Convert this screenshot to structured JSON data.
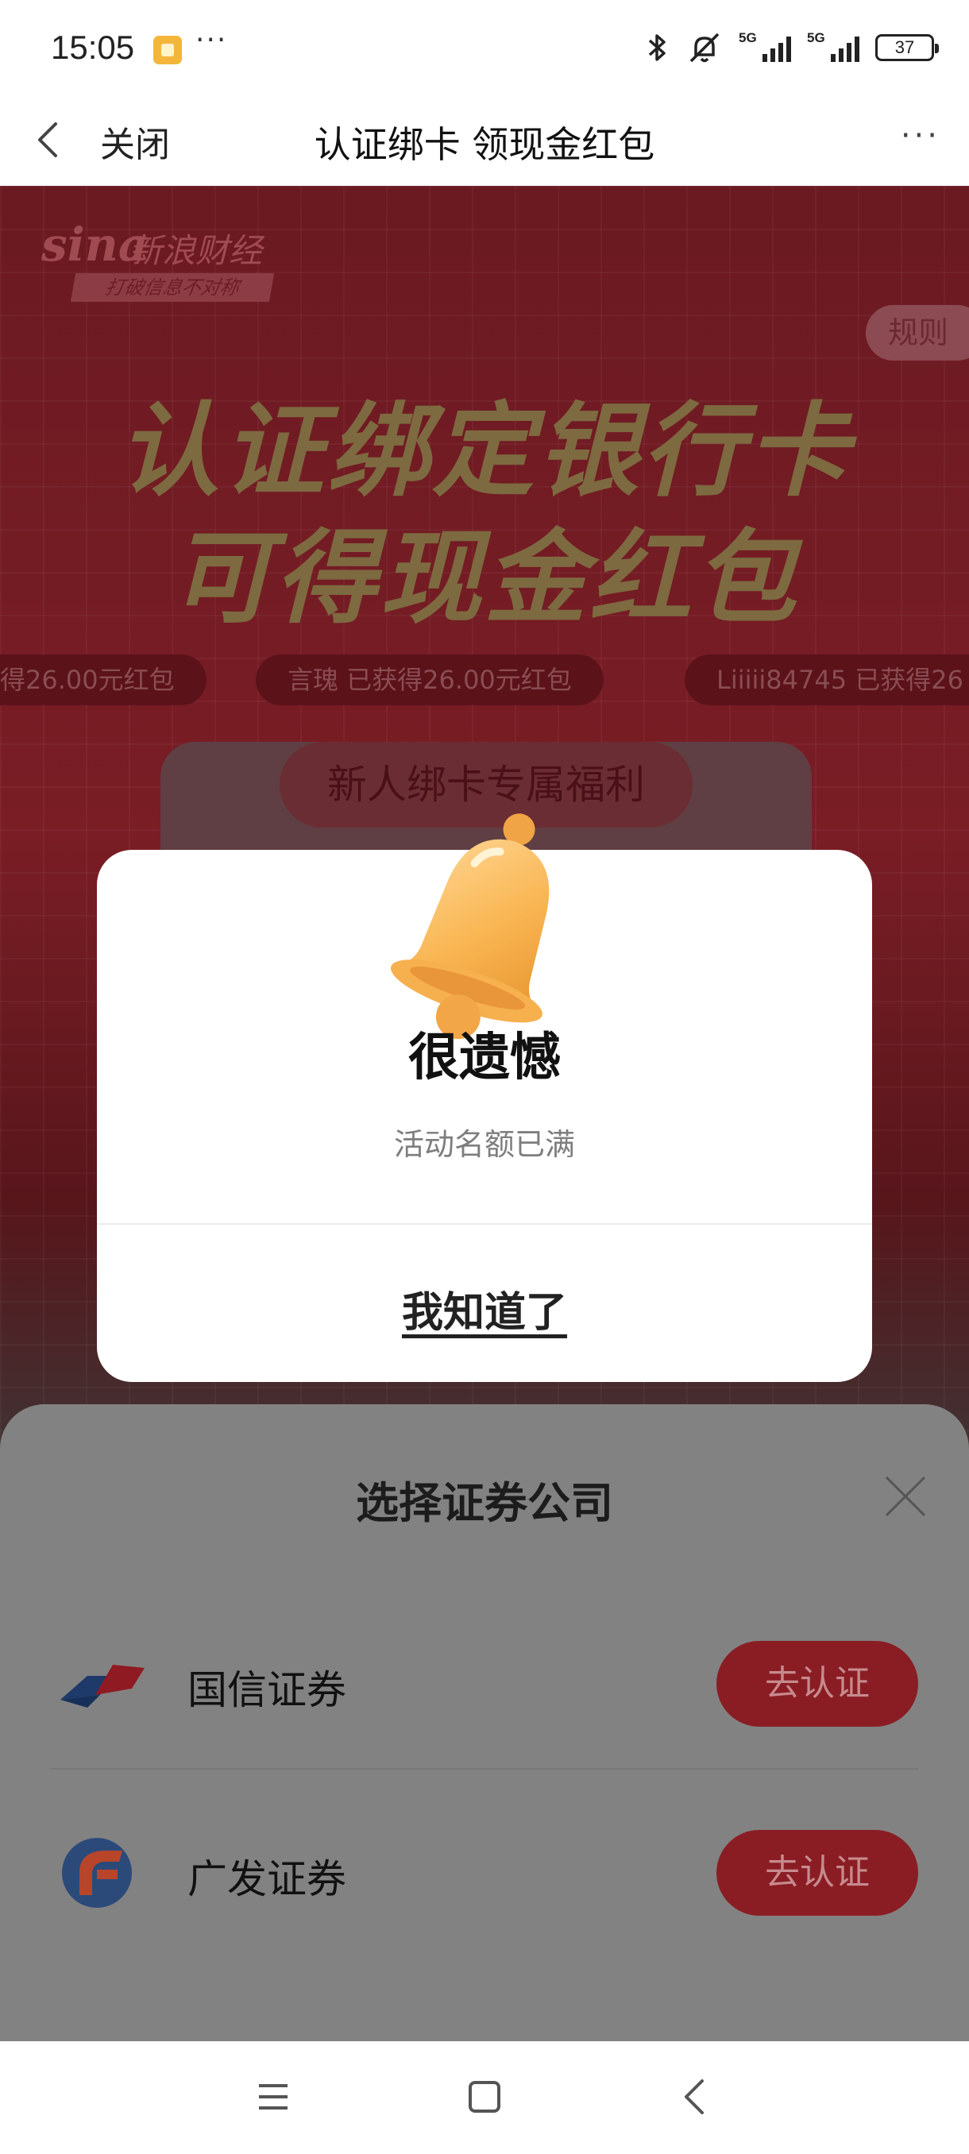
{
  "status_bar": {
    "time": "15:05",
    "more": "···",
    "signal1_tag": "5G",
    "signal2_tag": "5G",
    "battery": "37"
  },
  "nav": {
    "close_label": "关闭",
    "title": "认证绑卡 领现金红包",
    "more": "···"
  },
  "page": {
    "logo_word": "sina",
    "logo_cn": "新浪财经",
    "logo_slogan": "打破信息不对称",
    "rules_label": "规则",
    "headline_line1": "认证绑定银行卡",
    "headline_line2": "可得现金红包",
    "ticker": [
      "得26.00元红包",
      "言瑰  已获得26.00元红包",
      "Liiiii84745  已获得26"
    ],
    "newbie_tag": "新人绑卡专属福利"
  },
  "sheet": {
    "title": "选择证券公司",
    "brokers": [
      {
        "name": "国信证券",
        "action": "去认证"
      },
      {
        "name": "广发证券",
        "action": "去认证"
      }
    ]
  },
  "dialog": {
    "icon": "bell-icon",
    "title": "很遗憾",
    "message": "活动名额已满",
    "ok_label": "我知道了"
  },
  "colors": {
    "accent_red": "#8a1d24",
    "dialog_bg": "#ffffff",
    "bell": "#f7b24a"
  }
}
